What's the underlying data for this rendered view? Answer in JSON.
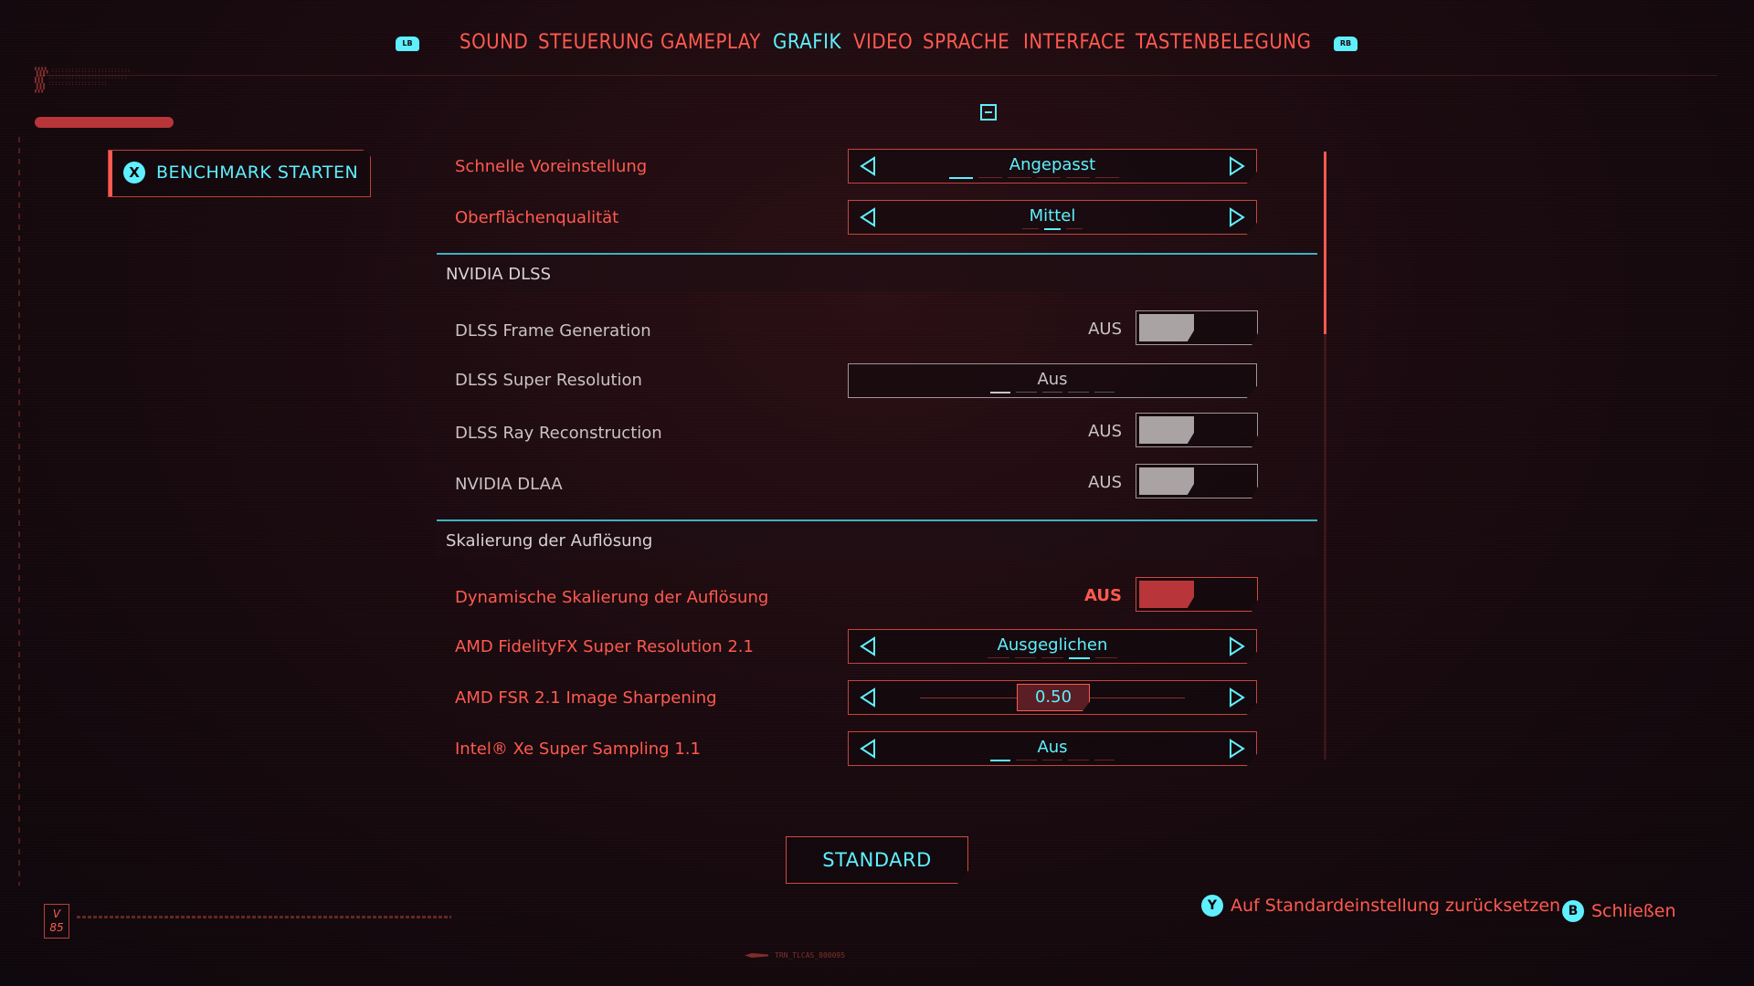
{
  "nav": {
    "left_bumper": "LB",
    "right_bumper": "RB",
    "tabs": [
      {
        "label": "SOUND"
      },
      {
        "label": "STEUERUNG"
      },
      {
        "label": "GAMEPLAY"
      },
      {
        "label": "GRAFIK"
      },
      {
        "label": "VIDEO"
      },
      {
        "label": "SPRACHE"
      },
      {
        "label": "INTERFACE"
      },
      {
        "label": "TASTENBELEGUNG"
      }
    ],
    "active_tab": "GRAFIK"
  },
  "benchmark": {
    "button_glyph": "X",
    "label": "BENCHMARK STARTEN"
  },
  "settings": {
    "preset": {
      "label": "Schnelle Voreinstellung",
      "value": "Angepasst"
    },
    "surface": {
      "label": "Oberflächenqualität",
      "value": "Mittel"
    },
    "section_dlss": {
      "title": "NVIDIA DLSS",
      "frame_generation": {
        "label": "DLSS Frame Generation",
        "state": "AUS"
      },
      "super_resolution": {
        "label": "DLSS Super Resolution",
        "value": "Aus"
      },
      "ray_reconstruction": {
        "label": "DLSS Ray Reconstruction",
        "state": "AUS"
      },
      "dlaa": {
        "label": "NVIDIA DLAA",
        "state": "AUS"
      }
    },
    "section_scaling": {
      "title": "Skalierung der Auflösung",
      "dynamic": {
        "label": "Dynamische Skalierung der Auflösung",
        "state": "AUS"
      },
      "fsr": {
        "label": "AMD FidelityFX Super Resolution 2.1",
        "value": "Ausgeglichen"
      },
      "sharpening": {
        "label": "AMD FSR 2.1 Image Sharpening",
        "value": "0.50"
      },
      "xess": {
        "label": "Intel® Xe Super Sampling 1.1",
        "value": "Aus"
      }
    }
  },
  "standard_button": "STANDARD",
  "hints": {
    "reset": {
      "glyph": "Y",
      "label": "Auf Standardeinstellung zurücksetzen"
    },
    "close": {
      "glyph": "B",
      "label": "Schließen"
    }
  },
  "badge": "V\n85",
  "bottom_code": "TRN_TLCAS_800095",
  "colors": {
    "accent": "#5ef0ff",
    "primary": "#ff5a4f",
    "background": "#1a0a0f",
    "section_line": "#3bb3c3"
  }
}
